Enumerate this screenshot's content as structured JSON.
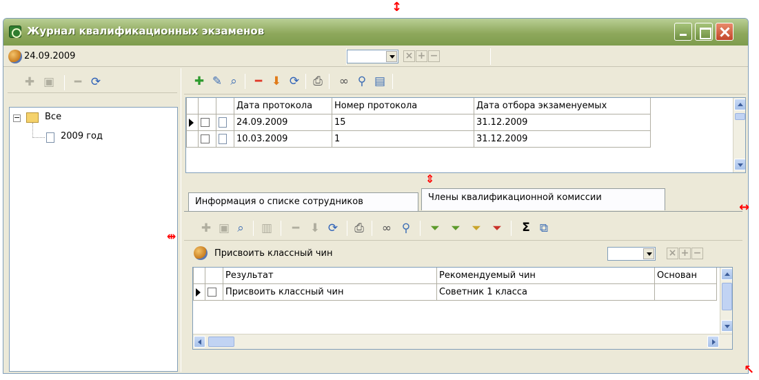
{
  "window": {
    "title": "Журнал квалификационных экзаменов",
    "icon": "app-logo-icon"
  },
  "filter_bar": {
    "date": "24.09.2009",
    "icon": "database-icon"
  },
  "left_toolbar": {
    "icons": [
      "add-icon",
      "edit-icon",
      "delete-icon",
      "refresh-icon"
    ]
  },
  "tree": {
    "root_label": "Все",
    "child_label": "2009 год"
  },
  "top_toolbar": {
    "icons": [
      "add-icon",
      "edit-icon",
      "search-icon",
      "delete-icon",
      "move-down-icon",
      "refresh-icon",
      "print-icon",
      "view-icon",
      "find-icon",
      "export-icon"
    ]
  },
  "protocols_grid": {
    "columns": [
      "Дата протокола",
      "Номер протокола",
      "Дата отбора экзаменуемых"
    ],
    "rows": [
      {
        "date": "24.09.2009",
        "number": "15",
        "selection_date": "31.12.2009"
      },
      {
        "date": "10.03.2009",
        "number": "1",
        "selection_date": "31.12.2009"
      }
    ]
  },
  "tabs": [
    {
      "label": "Информация о списке сотрудников",
      "active": true
    },
    {
      "label": "Члены квалификационной комиссии",
      "active": false
    }
  ],
  "bottom_toolbar": {
    "sum_label": "Σ"
  },
  "action_bar": {
    "selected": "Присвоить классный чин"
  },
  "results_grid": {
    "columns": [
      "Результат",
      "Рекомендуемый чин",
      "Основан"
    ],
    "rows": [
      {
        "result": "Присвоить классный чин",
        "rank": "Советник 1 класса",
        "basis": ""
      }
    ]
  },
  "colors": {
    "titlebar": "#8ea85c",
    "window_bg": "#ece9d8",
    "resize_marker": "#ff0000"
  }
}
